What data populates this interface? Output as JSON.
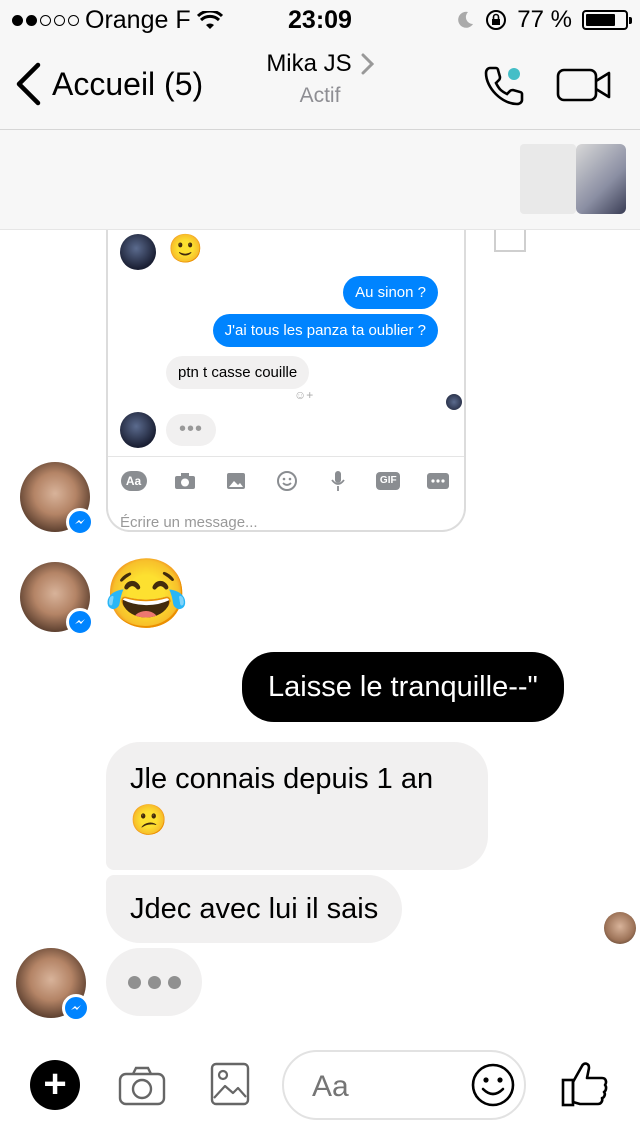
{
  "status_bar": {
    "carrier": "Orange F",
    "time": "23:09",
    "battery": "77 %",
    "battery_level": 0.77,
    "signal_dots_filled": 2,
    "signal_dots_total": 5
  },
  "nav": {
    "back_label": "Accueil (5)",
    "contact_name": "Mika JS",
    "contact_status": "Actif",
    "online_color": "#44bec7"
  },
  "shared_screenshot": {
    "messages": [
      {
        "side": "out",
        "text": "Au sinon ?"
      },
      {
        "side": "out",
        "text": "J'ai tous les panza ta oublier ?"
      },
      {
        "side": "in",
        "text": "ptn t casse couille"
      }
    ],
    "toolbar": [
      "Aa-icon",
      "camera-icon",
      "image-icon",
      "emoji-icon",
      "mic-icon",
      "GIF",
      "more-icon"
    ],
    "gif_label": "GIF",
    "aa_label": "Aa",
    "placeholder": "Écrire un message..."
  },
  "messages": {
    "emoji_reaction": "😂",
    "outgoing": "Laisse le tranquille--\"",
    "incoming_1_line1": "Jle connais depuis 1 an",
    "incoming_1_emoji": "😕",
    "incoming_2": "Jdec avec lui il sais",
    "typing_indicator": "..."
  },
  "composer": {
    "placeholder": "Aa"
  },
  "colors": {
    "messenger_blue": "#0084ff",
    "outgoing_bubble": "#000000",
    "incoming_bubble": "#f1f0f0"
  }
}
